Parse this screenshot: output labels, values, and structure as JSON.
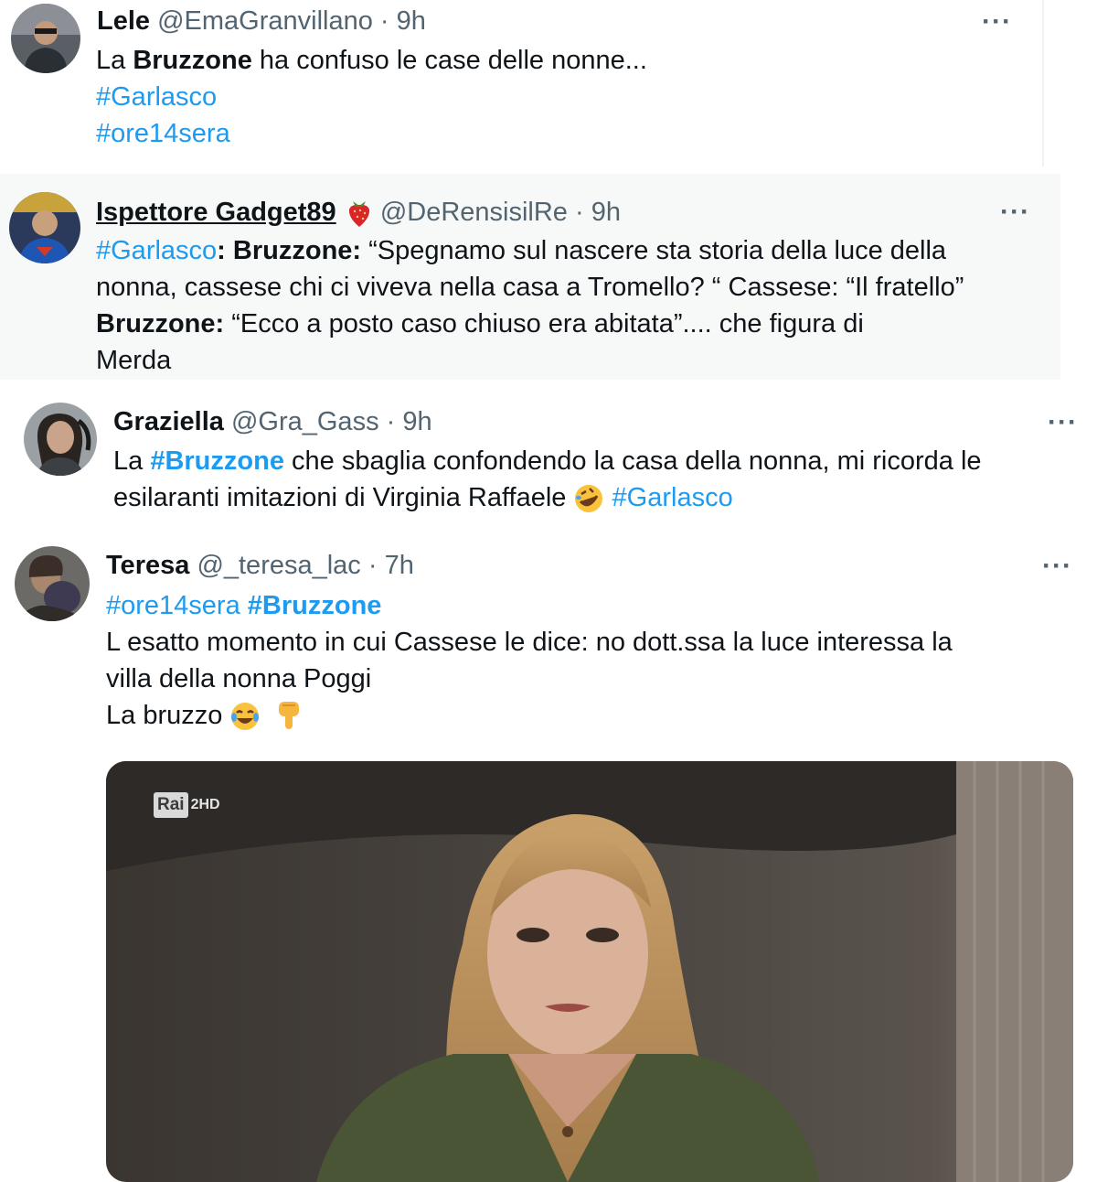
{
  "colors": {
    "link": "#1d9bf0",
    "text": "#0f1419",
    "muted": "#536471"
  },
  "tweets": [
    {
      "name": "Lele",
      "handle": "@EmaGranvillano",
      "sep": "·",
      "time": "9h",
      "more": "···",
      "text_pre": "La ",
      "text_bold": "Bruzzone",
      "text_post": " ha confuso le case delle nonne...",
      "hashtags": [
        "#Garlasco",
        "#ore14sera"
      ]
    },
    {
      "name": "Ispettore Gadget89",
      "handle": "@DeRensisilRe",
      "sep": "·",
      "time": "9h",
      "more": "···",
      "emoji_name": "strawberry",
      "hashtag": "#Garlasco",
      "colon": ":",
      "bold1": "Bruzzone:",
      "line1_rest": " “Spegnamo sul nascere sta storia della luce della",
      "line2": "nonna, cassese chi ci viveva nella casa a Tromello? “ Cassese: “Il fratello”",
      "bold2": "Bruzzone:",
      "line3_rest": " “Ecco a posto caso chiuso era abitata”.... che figura di",
      "line4": "Merda"
    },
    {
      "name": "Graziella",
      "handle": "@Gra_Gass",
      "sep": "·",
      "time": "9h",
      "more": "···",
      "pre": "La ",
      "hashtag_bold": "#Bruzzone",
      "line1_rest": " che sbaglia confondendo la casa della nonna, mi ricorda le",
      "line2": "esilaranti imitazioni di Virginia Raffaele ",
      "emoji_name": "rolling-on-floor-laughing",
      "hashtag_end": "#Garlasco"
    },
    {
      "name": "Teresa",
      "handle": "@_teresa_lac",
      "sep": "·",
      "time": "7h",
      "more": "···",
      "hashtag1": "#ore14sera",
      "hashtag2": "#Bruzzone",
      "line2": "L esatto momento in cui Cassese le dice: no dott.ssa la luce interessa la",
      "line3": "villa della nonna Poggi",
      "line4": "La bruzzo ",
      "emojis": [
        "face-with-tears-of-joy",
        "backhand-index-pointing-down"
      ],
      "media": {
        "channel_logo": "Rai",
        "channel_badge": "2HD"
      }
    }
  ]
}
